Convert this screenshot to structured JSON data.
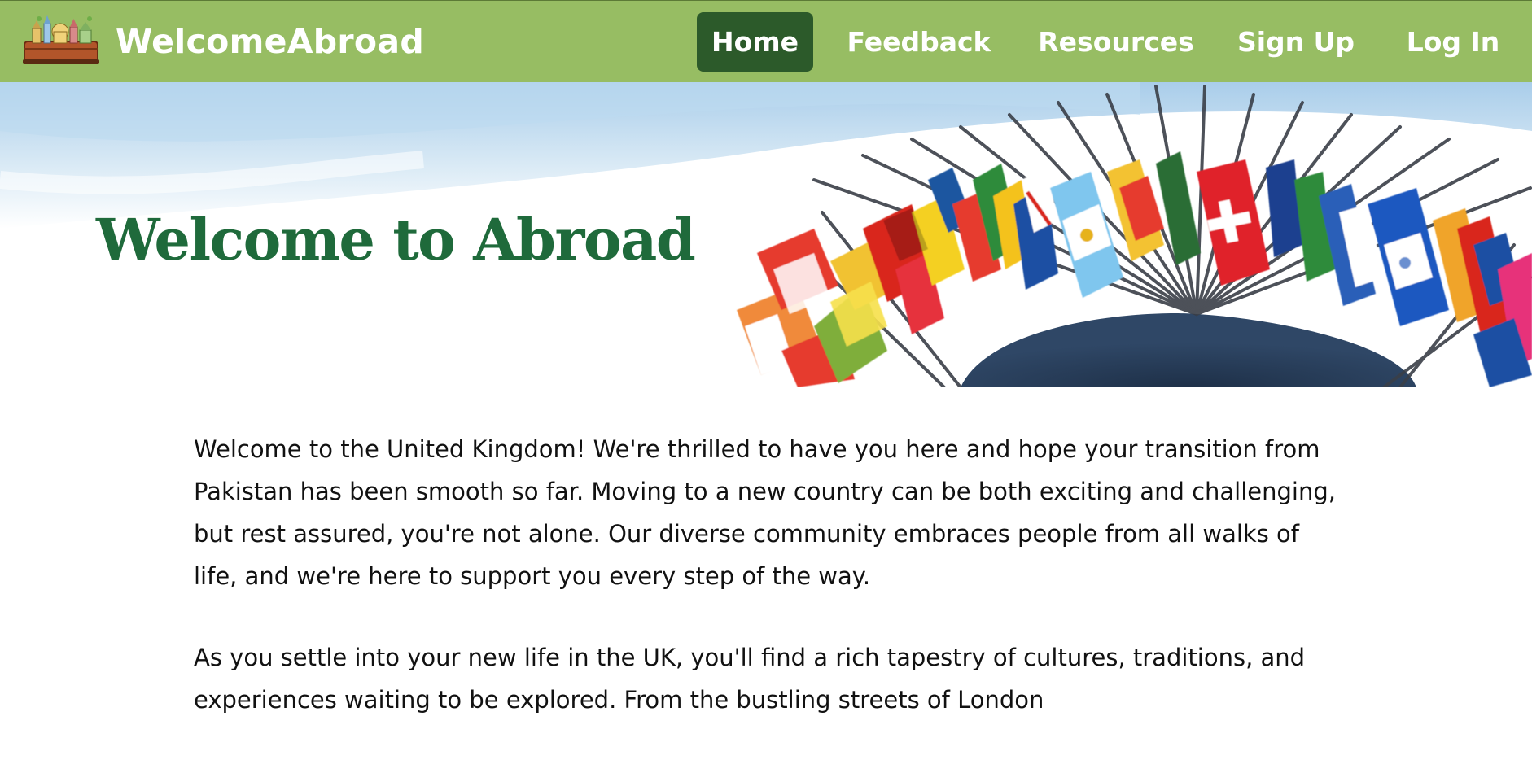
{
  "brand": {
    "name": "WelcomeAbroad",
    "logo_icon": "suitcase-landmarks-icon"
  },
  "nav": {
    "items": [
      {
        "label": "Home",
        "active": true
      },
      {
        "label": "Feedback",
        "active": false
      },
      {
        "label": "Resources",
        "active": false
      },
      {
        "label": "Sign Up",
        "active": false
      },
      {
        "label": "Log In",
        "active": false
      }
    ]
  },
  "hero": {
    "title": "Welcome  to Abroad",
    "image": "world-flags-banner"
  },
  "content": {
    "paragraphs": [
      "Welcome to the United Kingdom! We're thrilled to have you here and hope your transition from Pakistan has been smooth so far. Moving to a new country can be both exciting and challenging, but rest assured, you're not alone. Our diverse community embraces people from all walks of life, and we're here to support you every step of the way.",
      "As you settle into your new life in the UK, you'll find a rich tapestry of cultures, traditions, and experiences waiting to be explored. From the bustling streets of London"
    ]
  },
  "colors": {
    "nav_bg": "#97bd63",
    "nav_active_bg": "#2c5a2a",
    "title_green": "#1f6a3b",
    "text": "#111111"
  }
}
